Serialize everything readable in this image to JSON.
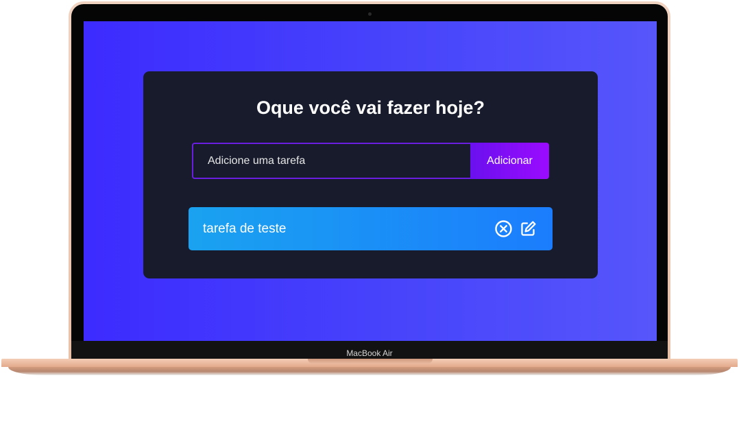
{
  "device": {
    "model_label": "MacBook Air"
  },
  "app": {
    "title": "Oque você vai fazer hoje?",
    "form": {
      "placeholder": "Adicione uma tarefa",
      "value": "",
      "submit_label": "Adicionar"
    },
    "tasks": [
      {
        "text": "tarefa de teste",
        "actions": [
          "close-circle-icon",
          "edit-icon"
        ]
      }
    ]
  },
  "colors": {
    "screen_background": "#3d2bff",
    "card_background": "#171b2c",
    "input_border": "#6a1fe0",
    "button_gradient_end": "#9b0bff",
    "task_gradient_start": "#1aa2f0",
    "task_gradient_end": "#1b7dfd"
  }
}
